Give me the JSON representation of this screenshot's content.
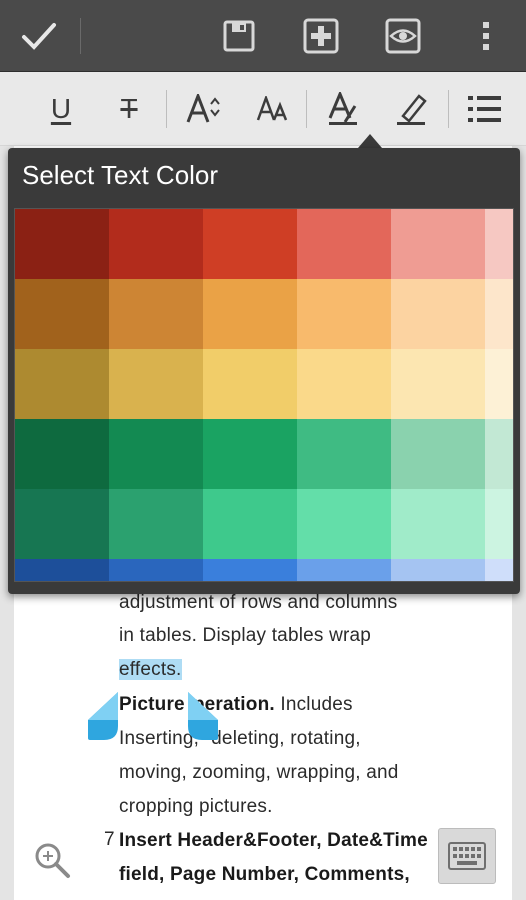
{
  "action_bar": {
    "done_icon": "check-icon",
    "save_icon": "save-icon",
    "insert_icon": "plus-box-icon",
    "view_icon": "eye-icon",
    "overflow_icon": "more-vertical-icon"
  },
  "format_bar": {
    "underline_label": "U",
    "strikethrough_label": "T",
    "grow_font_icon": "font-size-increase-icon",
    "font_case_icon": "font-case-icon",
    "text_color_icon": "text-color-icon",
    "highlight_icon": "highlighter-icon",
    "list_icon": "bullet-list-icon"
  },
  "color_popup": {
    "title": "Select Text Color",
    "rows": [
      [
        "#8b2114",
        "#b22c1c",
        "#cf3e25",
        "#e3675a",
        "#ef9c93",
        "#f6c8c2"
      ],
      [
        "#a1621c",
        "#cd8534",
        "#eaa246",
        "#f8ba6c",
        "#fcd3a1",
        "#fde6cb"
      ],
      [
        "#ad8a30",
        "#d9b24e",
        "#f1cd69",
        "#fad98a",
        "#fce6b1",
        "#fdf1d6"
      ],
      [
        "#0e6a3f",
        "#138a52",
        "#1aa362",
        "#3fbb83",
        "#8ad2ae",
        "#c2e8d4"
      ],
      [
        "#177652",
        "#2ba16f",
        "#3ec98c",
        "#63dea9",
        "#a0ebc9",
        "#ccf4e1"
      ],
      [
        "#1d4f9a",
        "#2a66bd",
        "#3a7fdc",
        "#6aa0ea",
        "#a5c4f2",
        "#cfdefa"
      ]
    ]
  },
  "document": {
    "line1": "adjustment of rows and columns",
    "line2": "in tables. Display tables wrap",
    "line3_highlight": "effects.",
    "line4_bold": "Picture",
    "line4_bold_b": "peration.",
    "line4_rest": " Includes",
    "line5_a": "Inserting,",
    "line5_b": "deleting, rotating,",
    "line6": "moving, zooming, wrapping, and",
    "line7": "cropping pictures.",
    "item_number": "7",
    "line8_bold": "Insert Header&Footer, Date&Time",
    "line9_bold": "field, Page Number, Comments,"
  },
  "bottom": {
    "zoom_icon": "zoom-icon",
    "keyboard_icon": "keyboard-icon"
  }
}
